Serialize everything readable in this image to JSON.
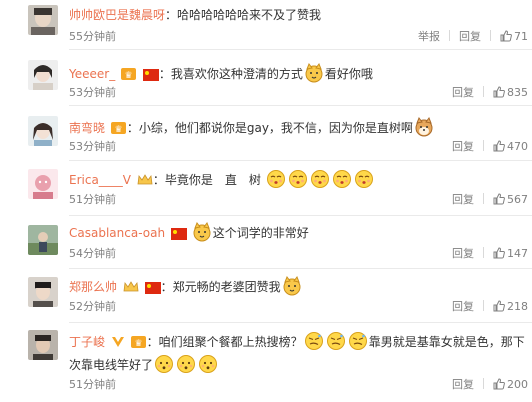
{
  "comments": [
    {
      "username": "帅帅欧巴是魏晨呀",
      "text": "：哈哈哈哈哈哈来不及了赞我",
      "time": "55分钟前",
      "report": "举报",
      "reply": "回复",
      "likes": "71",
      "emoji": []
    },
    {
      "username": "Yeeeer_",
      "text": "：我喜欢你这种澄清的方式",
      "text2": "看好你哦",
      "time": "53分钟前",
      "reply": "回复",
      "likes": "835",
      "emoji": [
        "dog-face"
      ]
    },
    {
      "username": "南弯晓",
      "text": "：小综，他们都说你是gay，我不信，因为你是直树啊",
      "time": "53分钟前",
      "reply": "回复",
      "likes": "470",
      "emoji": [
        "shiba-face"
      ]
    },
    {
      "username": "Erica____V",
      "text": "：毕竟你是　直　树",
      "time": "51分钟前",
      "reply": "回复",
      "likes": "567",
      "emoji": [
        "kiss-face",
        "kiss-face",
        "kiss-face",
        "kiss-face",
        "kiss-face"
      ]
    },
    {
      "username": "Casablanca-oah",
      "text": "这个词学的非常好",
      "time": "54分钟前",
      "reply": "回复",
      "likes": "147",
      "emoji": [
        "dog-face"
      ]
    },
    {
      "username": "郑那么帅",
      "text": "：郑元畅的老婆团赞我",
      "time": "52分钟前",
      "reply": "回复",
      "likes": "218",
      "emoji": [
        "dog-face"
      ]
    },
    {
      "username": "丁子峻",
      "text": "：咱们组聚个餐都上热搜榜？",
      "text2": "靠男就是基靠女就是色，那下",
      "text3": "次靠电线竿好了",
      "time": "51分钟前",
      "reply": "回复",
      "likes": "200",
      "emoji": [
        "smirk-face",
        "smirk-face",
        "smirk-face",
        "blush-face",
        "blush-face",
        "blush-face"
      ]
    }
  ],
  "colors": {
    "username": "#eb7350",
    "text": "#333333",
    "meta": "#808080",
    "divider": "#eaeaea"
  }
}
